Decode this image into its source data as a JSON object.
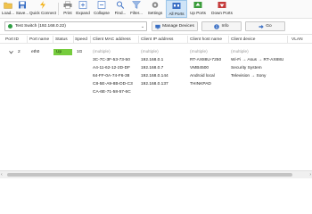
{
  "toolbar": {
    "buttons": [
      {
        "label": "Load...",
        "icon": "folder-open-icon"
      },
      {
        "label": "Save...",
        "icon": "save-icon"
      },
      {
        "label": "Quick Connect",
        "icon": "lightning-icon"
      },
      {
        "label": "Print",
        "icon": "print-icon"
      },
      {
        "label": "Expand",
        "icon": "expand-icon"
      },
      {
        "label": "Collapse",
        "icon": "collapse-icon"
      },
      {
        "label": "Find...",
        "icon": "find-icon"
      },
      {
        "label": "Filter...",
        "icon": "filter-icon"
      },
      {
        "label": "Settings",
        "icon": "settings-icon"
      },
      {
        "label": "All Ports",
        "icon": "all-ports-icon",
        "active": true
      },
      {
        "label": "Up Ports",
        "icon": "up-ports-icon"
      },
      {
        "label": "Down Ports",
        "icon": "down-ports-icon"
      }
    ]
  },
  "addressbar": {
    "switch_value": "Test Switch (192.168.0.22)",
    "manage_devices": "Manage Devices",
    "info": "Info",
    "go": "Go"
  },
  "table": {
    "headers": [
      "Port ID",
      "Port name",
      "Status",
      "Speed",
      "Client MAC address",
      "Client IP address",
      "Client host name",
      "Client device",
      "VLAN"
    ],
    "row": {
      "port_id": "2",
      "port_name": "eth0",
      "status": "Up",
      "speed": "1G",
      "macs": [
        "(multiple)",
        "3C-7C-3F-53-73-50",
        "A4-11-62-12-2D-DF",
        "64-FF-0A-74-F6-38",
        "C8-5E-A9-8B-DD-C3",
        "CA-6E-71-58-57-6C"
      ],
      "ips": [
        "(multiple)",
        "192.168.0.1",
        "192.168.0.7",
        "192.168.0.144",
        "192.168.0.137",
        ""
      ],
      "hosts": [
        "(multiple)",
        "RT-AX88U-7250",
        "VMB4500",
        "Android local",
        "THINKPAD",
        ""
      ],
      "devices": [
        "(multiple)",
        "Wi-Fi → Asus → RT-AX88U",
        "Security System",
        "Television → Sony",
        "",
        ""
      ]
    }
  },
  "colors": {
    "status_up": "#76cc3d",
    "active_tab": "#cfe4f7",
    "link_dot": "#2f9e44"
  }
}
